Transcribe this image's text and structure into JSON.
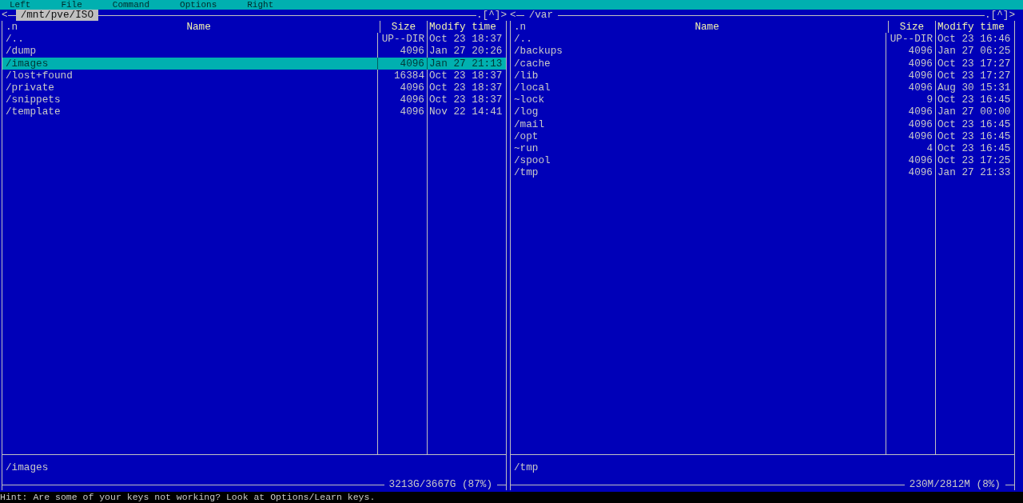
{
  "menu_bar": [
    "Left",
    "File",
    "Command",
    "Options",
    "Right"
  ],
  "panels": [
    {
      "nav_left": "<",
      "path": "/mnt/pve/ISO",
      "active": true,
      "nav_right": ".[^]>",
      "columns": [
        ".n",
        "Name",
        "Size",
        "Modify time"
      ],
      "rows": [
        {
          "name": "/..",
          "size": "UP--DIR",
          "time": "Oct 23 18:37",
          "selected": false
        },
        {
          "name": "/dump",
          "size": "4096",
          "time": "Jan 27 20:26",
          "selected": false
        },
        {
          "name": "/images",
          "size": "4096",
          "time": "Jan 27 21:13",
          "selected": true
        },
        {
          "name": "/lost+found",
          "size": "16384",
          "time": "Oct 23 18:37",
          "selected": false
        },
        {
          "name": "/private",
          "size": "4096",
          "time": "Oct 23 18:37",
          "selected": false
        },
        {
          "name": "/snippets",
          "size": "4096",
          "time": "Oct 23 18:37",
          "selected": false
        },
        {
          "name": "/template",
          "size": "4096",
          "time": "Nov 22 14:41",
          "selected": false
        }
      ],
      "mini_status": "/images",
      "disk_usage": "3213G/3667G (87%)"
    },
    {
      "nav_left": "<",
      "path": "/var",
      "active": false,
      "nav_right": ".[^]>",
      "columns": [
        ".n",
        "Name",
        "Size",
        "Modify time"
      ],
      "rows": [
        {
          "name": "/..",
          "size": "UP--DIR",
          "time": "Oct 23 16:46",
          "selected": false
        },
        {
          "name": "/backups",
          "size": "4096",
          "time": "Jan 27 06:25",
          "selected": false
        },
        {
          "name": "/cache",
          "size": "4096",
          "time": "Oct 23 17:27",
          "selected": false
        },
        {
          "name": "/lib",
          "size": "4096",
          "time": "Oct 23 17:27",
          "selected": false
        },
        {
          "name": "/local",
          "size": "4096",
          "time": "Aug 30 15:31",
          "selected": false
        },
        {
          "name": "~lock",
          "size": "9",
          "time": "Oct 23 16:45",
          "selected": false
        },
        {
          "name": "/log",
          "size": "4096",
          "time": "Jan 27 00:00",
          "selected": false
        },
        {
          "name": "/mail",
          "size": "4096",
          "time": "Oct 23 16:45",
          "selected": false
        },
        {
          "name": "/opt",
          "size": "4096",
          "time": "Oct 23 16:45",
          "selected": false
        },
        {
          "name": "~run",
          "size": "4",
          "time": "Oct 23 16:45",
          "selected": false
        },
        {
          "name": "/spool",
          "size": "4096",
          "time": "Oct 23 17:25",
          "selected": false
        },
        {
          "name": "/tmp",
          "size": "4096",
          "time": "Jan 27 21:33",
          "selected": false
        }
      ],
      "mini_status": "/tmp",
      "disk_usage": "230M/2812M (8%)"
    }
  ],
  "hint": "Hint: Are some of your keys not working? Look at Options/Learn keys."
}
